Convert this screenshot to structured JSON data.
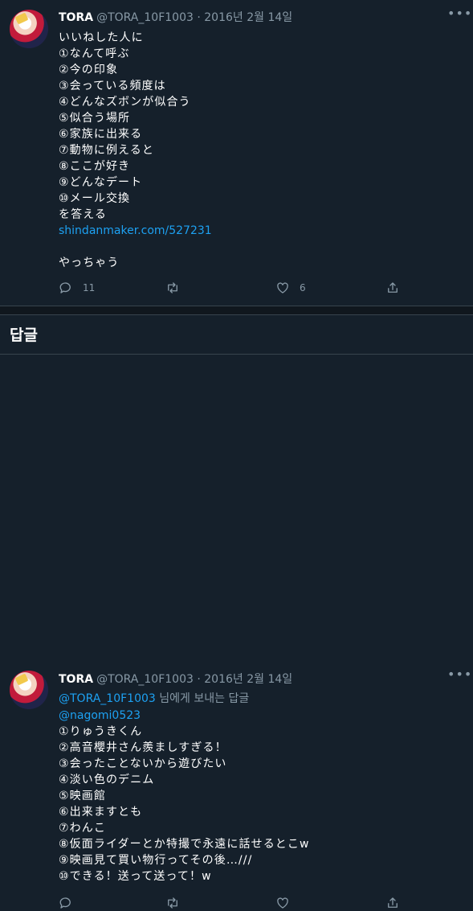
{
  "colors": {
    "background": "#15202b",
    "text": "#ffffff",
    "muted": "#8899a6",
    "link": "#1da1f2",
    "border": "#38444d"
  },
  "tweet1": {
    "name": "TORA",
    "handle": "@TORA_10F1003",
    "separator": "·",
    "date": "2016년 2월 14일",
    "lines": [
      "いいねした人に",
      "①なんて呼ぶ",
      "②今の印象",
      "③会っている頻度は",
      "④どんなズボンが似合う",
      "⑤似合う場所",
      "⑥家族に出来る",
      "⑦動物に例えると",
      "⑧ここが好き",
      "⑨どんなデート",
      "⑩メール交換",
      "を答える"
    ],
    "link": "shindanmaker.com/527231",
    "closing": "やっちゃう",
    "reply_count": "11",
    "like_count": "6",
    "icons": [
      "reply-icon",
      "retweet-icon",
      "like-icon",
      "share-icon",
      "more-icon"
    ]
  },
  "section_title": "답글",
  "tweet2": {
    "name": "TORA",
    "handle": "@TORA_10F1003",
    "separator": "·",
    "date": "2016년 2월 14일",
    "reply_to_handle": "@TORA_10F1003",
    "reply_to_suffix": " 님에게 보내는 답글",
    "mention": "@nagomi0523",
    "lines": [
      "①りゅうきくん",
      "②高音櫻井さん羨ましすぎる！",
      "③会ったことないから遊びたい",
      "④淡い色のデニム",
      "⑤映画館",
      "⑥出来ますとも",
      "⑦わんこ",
      "⑧仮面ライダーとか特撮で永遠に話せるとこw",
      "⑨映画見て買い物行ってその後…///",
      "⑩できる！送って送って！w"
    ]
  }
}
